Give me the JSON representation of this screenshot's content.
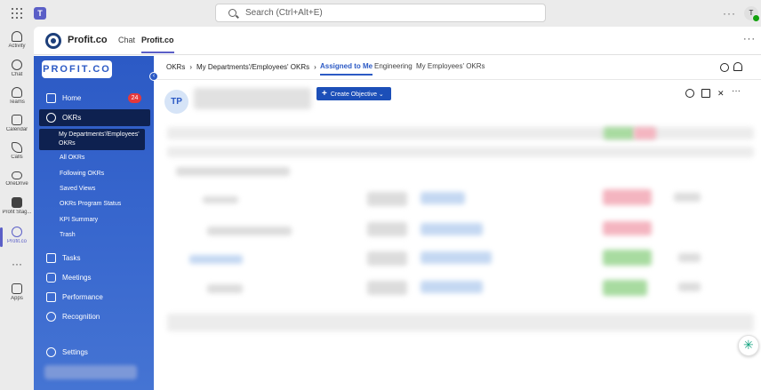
{
  "topbar": {
    "search_placeholder": "Search (Ctrl+Alt+E)",
    "avatar_initial": "T"
  },
  "rail": [
    {
      "label": "Activity"
    },
    {
      "label": "Chat"
    },
    {
      "label": "Teams"
    },
    {
      "label": "Calendar"
    },
    {
      "label": "Calls"
    },
    {
      "label": "OneDrive"
    },
    {
      "label": "Profit Stag..."
    },
    {
      "label": "Profit.co"
    },
    {
      "label": "Apps"
    }
  ],
  "apphead": {
    "name": "Profit.co",
    "tabs": [
      "Chat",
      "Profit.co"
    ]
  },
  "sidebar": {
    "brand": "PROFIT.CO",
    "home": "Home",
    "home_badge": "24",
    "okrs": "OKRs",
    "okr_sub": [
      "My Departments'/Employees' OKRs",
      "All OKRs",
      "Following OKRs",
      "Saved Views",
      "OKRs Program Status",
      "KPI Summary",
      "Trash"
    ],
    "tasks": "Tasks",
    "meetings": "Meetings",
    "performance": "Performance",
    "recognition": "Recognition",
    "settings": "Settings"
  },
  "content": {
    "breadcrumb": [
      "OKRs",
      "My Departments'/Employees' OKRs"
    ],
    "tabs": [
      "Assigned to Me",
      "Engineering",
      "My Employees' OKRs"
    ],
    "avatar": "TP",
    "create_button": "Create Objective"
  },
  "colors": {
    "brand": "#2c5ac5",
    "teams": "#5b5fc7",
    "badge": "#e5383b"
  }
}
